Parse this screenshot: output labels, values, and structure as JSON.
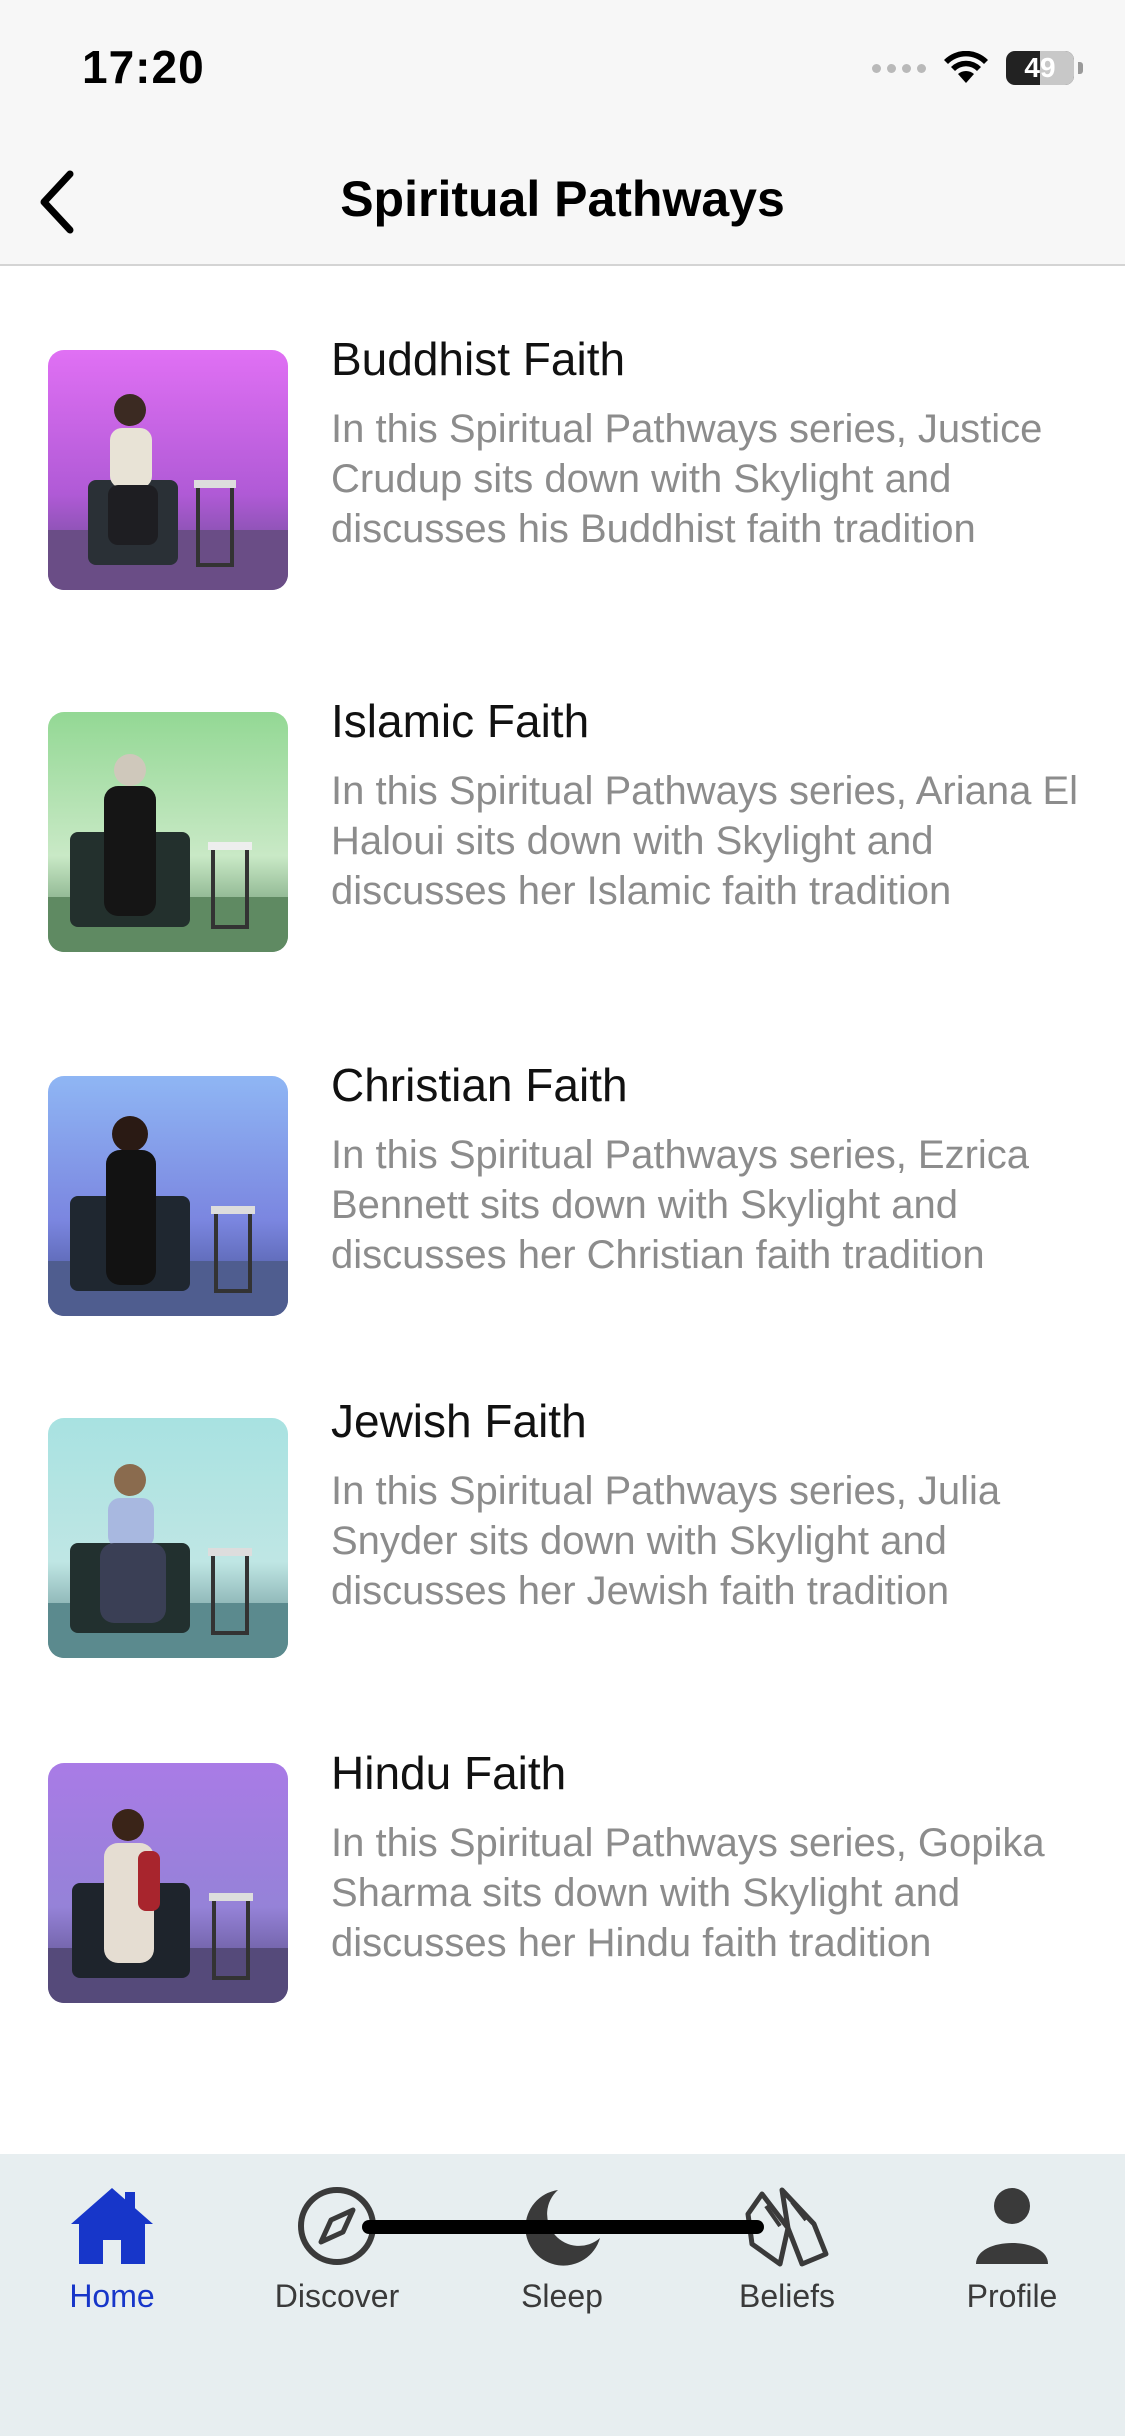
{
  "status_bar": {
    "time": "17:20",
    "battery": "49",
    "battery_level": 0.49
  },
  "nav": {
    "title": "Spiritual Pathways",
    "back_icon": "chevron-left-icon"
  },
  "items": [
    {
      "title": "Buddhist Faith",
      "description": "In this Spiritual Pathways series, Justice Crudup sits down with Skylight and discusses his Buddhist faith tradition",
      "thumb_bg": [
        "#d56df0",
        "#8a5bc2"
      ]
    },
    {
      "title": "Islamic Faith",
      "description": "In this Spiritual Pathways series, Ariana El Haloui sits down with Skylight and discusses her Islamic faith tradition",
      "thumb_bg": [
        "#8fd090",
        "#4e8a5f"
      ]
    },
    {
      "title": "Christian Faith",
      "description": "In this Spiritual Pathways series, Ezrica Bennett sits down with Skylight and discusses her Christian faith tradition",
      "thumb_bg": [
        "#8fb3f2",
        "#5565c9"
      ]
    },
    {
      "title": "Jewish Faith",
      "description": "In this Spiritual Pathways series, Julia Snyder sits down with Skylight and discusses her Jewish faith tradition",
      "thumb_bg": [
        "#a7e0df",
        "#5b9ea4"
      ]
    },
    {
      "title": "Hindu Faith",
      "description": "In this Spiritual Pathways series, Gopika Sharma sits down with Skylight and discusses her Hindu faith tradition",
      "thumb_bg": [
        "#a977e3",
        "#6b4bb6"
      ]
    }
  ],
  "tabs": [
    {
      "label": "Home",
      "icon": "home-icon",
      "active": true
    },
    {
      "label": "Discover",
      "icon": "compass-icon",
      "active": false
    },
    {
      "label": "Sleep",
      "icon": "moon-icon",
      "active": false
    },
    {
      "label": "Beliefs",
      "icon": "praying-hands-icon",
      "active": false
    },
    {
      "label": "Profile",
      "icon": "person-icon",
      "active": false
    }
  ],
  "colors": {
    "accent": "#1736c9",
    "tab_bar_bg": "#e7eef0",
    "desc_text": "#8c8c8c"
  }
}
